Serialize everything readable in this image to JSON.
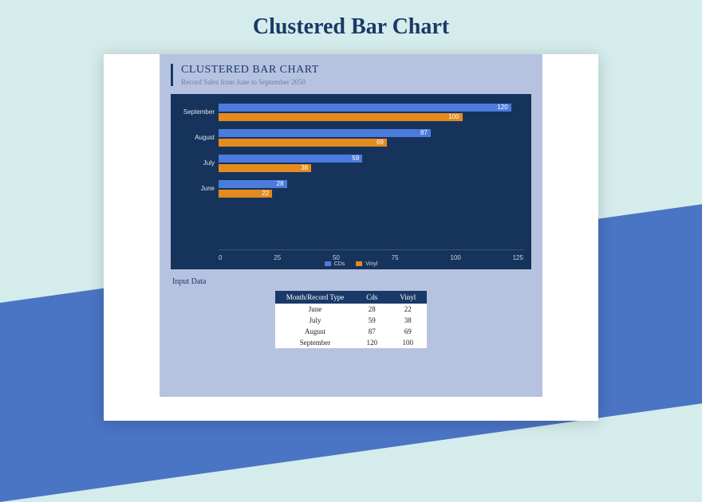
{
  "page_title": "Clustered Bar Chart",
  "header": {
    "title": "CLUSTERED BAR CHART",
    "subtitle": "Record Sales from June to September 2050"
  },
  "chart_data": {
    "type": "bar",
    "orientation": "horizontal",
    "categories": [
      "September",
      "August",
      "July",
      "June"
    ],
    "series": [
      {
        "name": "CDs",
        "values": [
          120,
          87,
          59,
          28
        ],
        "color": "#4b7bdc"
      },
      {
        "name": "Vinyl",
        "values": [
          100,
          69,
          38,
          22
        ],
        "color": "#e48a1f"
      }
    ],
    "xlim": [
      0,
      125
    ],
    "xticks": [
      0,
      25,
      50,
      75,
      100,
      125
    ],
    "title": "",
    "xlabel": "",
    "ylabel": ""
  },
  "legend": {
    "cds": "CDs",
    "vinyl": "Vinyl"
  },
  "input_data": {
    "title": "Input Data",
    "columns": [
      "Month/Record Type",
      "Cds",
      "Vinyl"
    ],
    "rows": [
      [
        "June",
        "28",
        "22"
      ],
      [
        "July",
        "59",
        "38"
      ],
      [
        "August",
        "87",
        "69"
      ],
      [
        "September",
        "120",
        "100"
      ]
    ]
  }
}
